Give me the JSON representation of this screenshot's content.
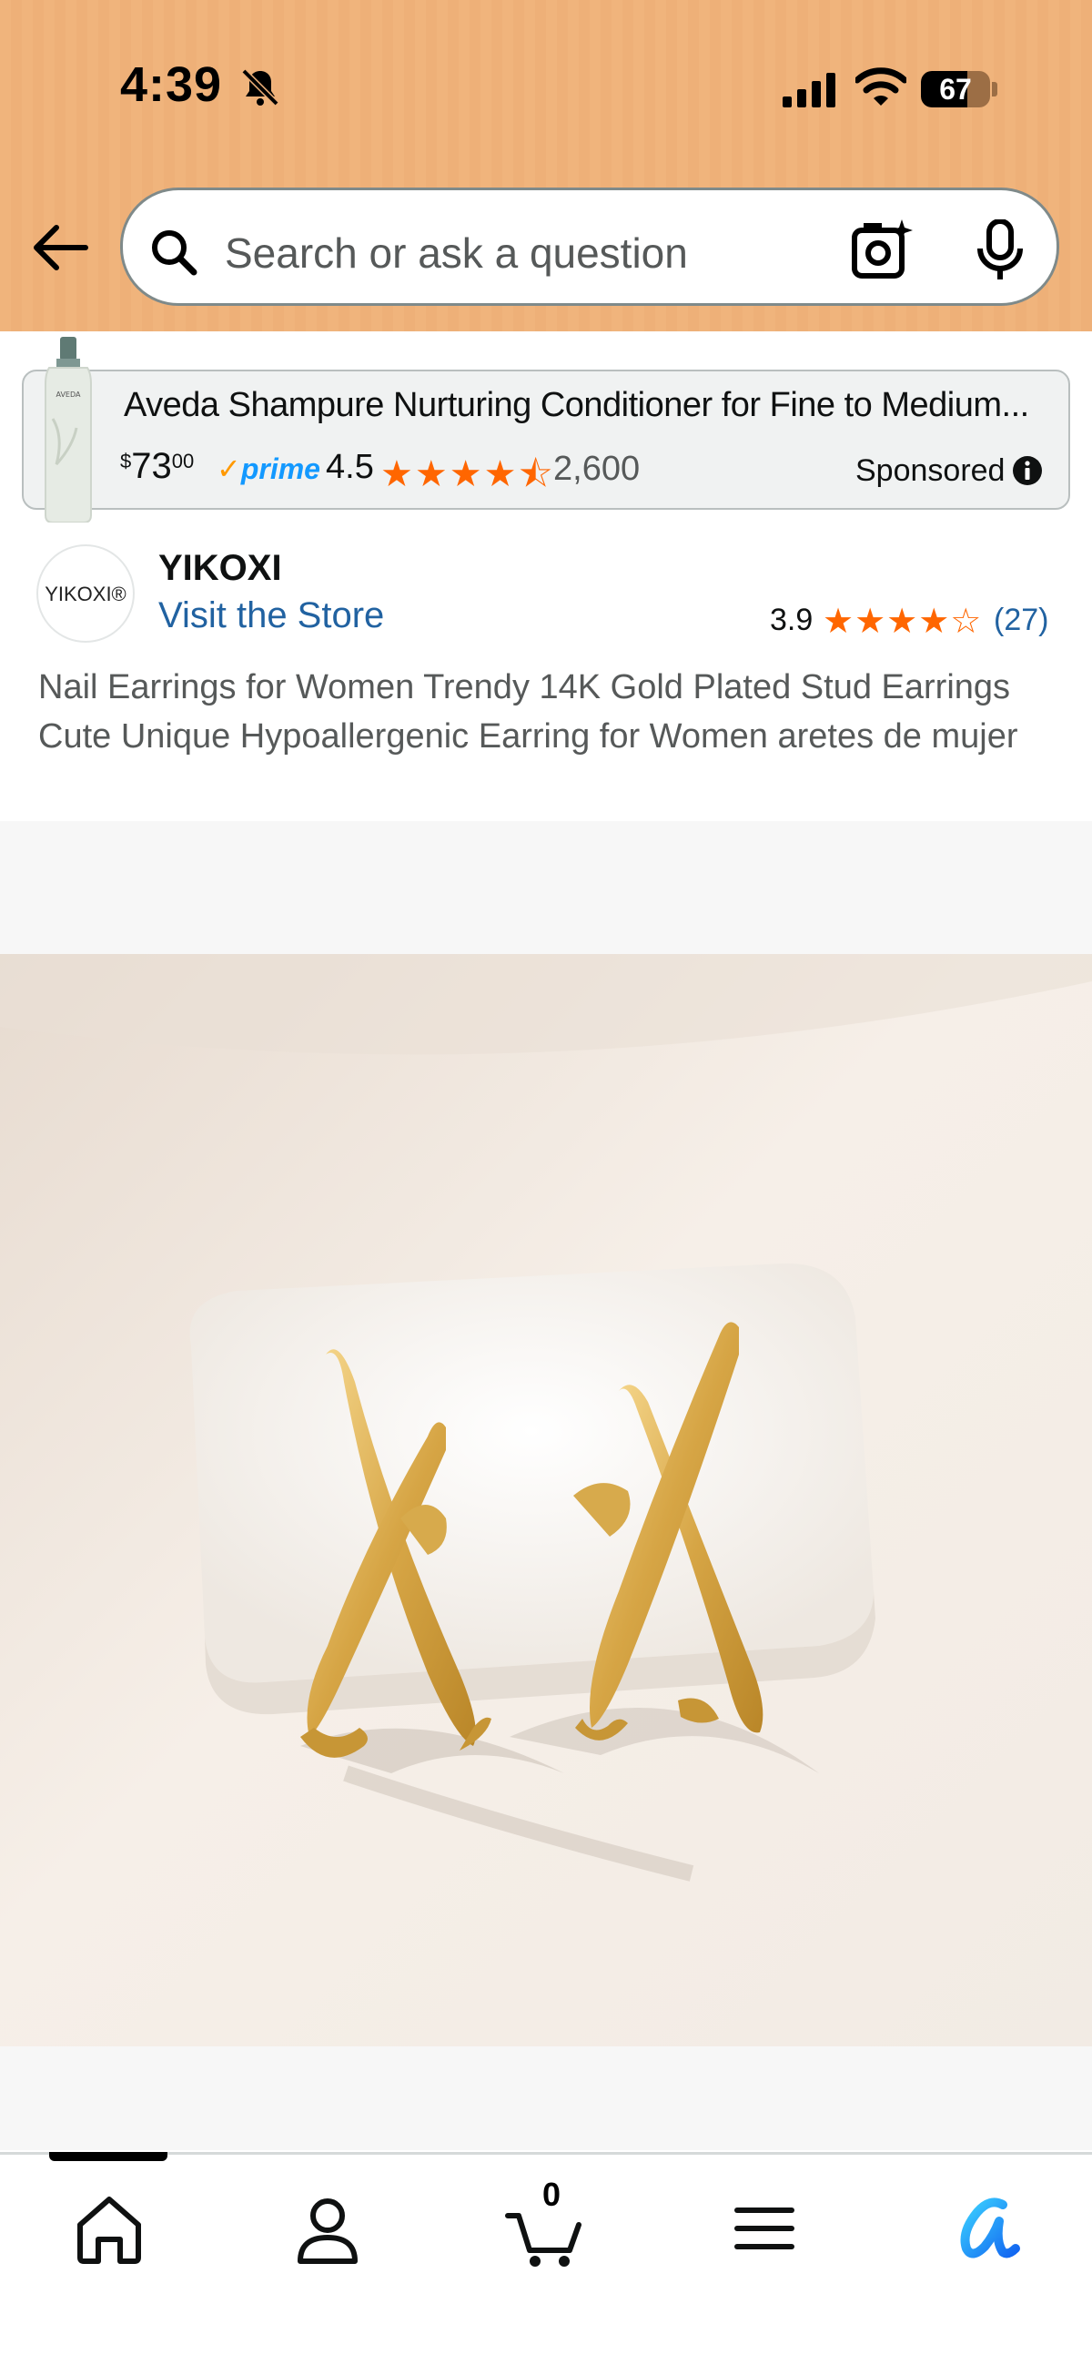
{
  "status_bar": {
    "time": "4:39",
    "battery": "67",
    "battery_level": 0.67
  },
  "search": {
    "placeholder": "Search or ask a question"
  },
  "sponsored_ad": {
    "title": "Aveda Shampure Nurturing Conditioner for Fine to Medium...",
    "price_currency": "$",
    "price_whole": "73",
    "price_fraction": "00",
    "prime_label": "prime",
    "rating": "4.5",
    "stars": "★★★★⯪",
    "review_count": "2,600",
    "sponsored_label": "Sponsored",
    "bottle_brand": "AVEDA"
  },
  "seller": {
    "logo_text": "YIKOXI®",
    "name": "YIKOXI",
    "visit_store_label": "Visit the Store",
    "rating": "3.9",
    "stars": "★★★★☆",
    "review_count": "(27)"
  },
  "product": {
    "title": "Nail Earrings for Women Trendy 14K Gold Plated Stud Earrings Cute Unique Hypoallergenic Earring for Women aretes de mujer"
  },
  "bottom_nav": {
    "cart_count": "0",
    "items": [
      "home-icon",
      "account-icon",
      "cart-icon",
      "menu-icon",
      "rufus-icon"
    ]
  },
  "colors": {
    "header_bg": "#f0b47c",
    "link": "#2162a1",
    "star": "#ff6600",
    "prime": "#1399ff"
  }
}
